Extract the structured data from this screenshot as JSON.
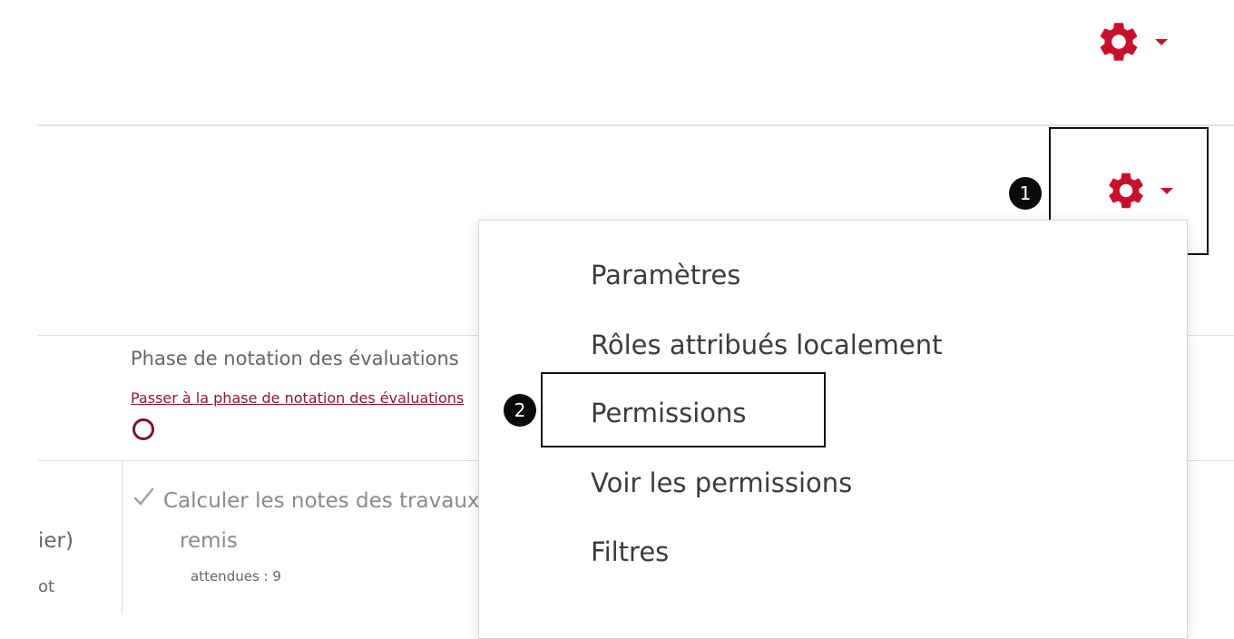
{
  "colors": {
    "accent": "#c8102e",
    "link": "#8b1c2a",
    "muted_text": "#8a8a8a"
  },
  "icons": {
    "gear": "gear-icon",
    "caret": "caret-down-icon",
    "check": "check-icon",
    "circle": "circle-icon"
  },
  "phase": {
    "title": "Phase de notation des évaluations",
    "link": "Passer à la phase de notation des évaluations"
  },
  "task": {
    "label_line1": "Calculer les notes des travaux",
    "label_line2": "remis",
    "expected": "attendues : 9"
  },
  "left_fragments": {
    "line1": "ier)",
    "line2": "ot"
  },
  "menu": {
    "items": [
      {
        "label": "Paramètres"
      },
      {
        "label": "Rôles attribués localement"
      },
      {
        "label": "Permissions"
      },
      {
        "label": "Voir les permissions"
      },
      {
        "label": "Filtres"
      }
    ]
  },
  "badges": {
    "one": "1",
    "two": "2"
  }
}
